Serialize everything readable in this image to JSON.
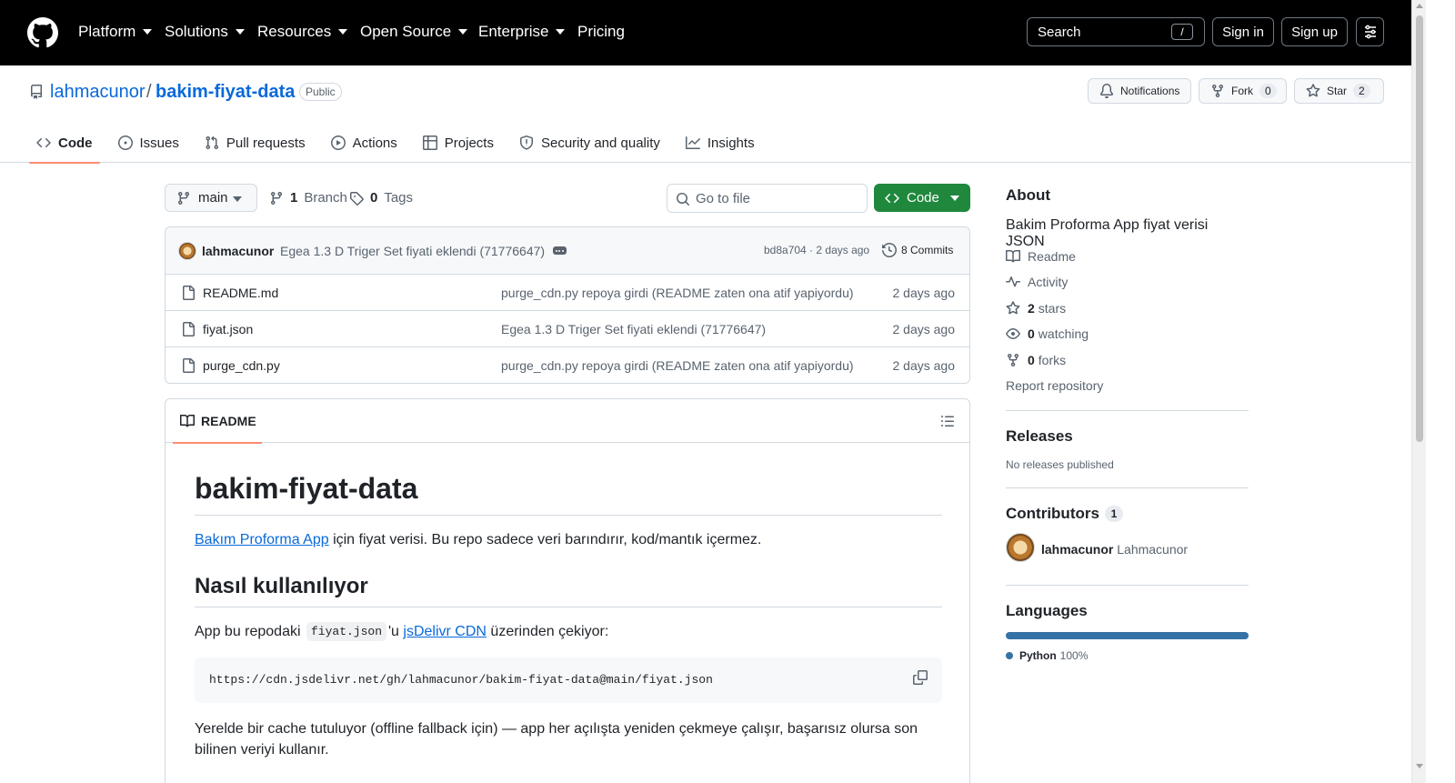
{
  "header": {
    "nav": [
      "Platform",
      "Solutions",
      "Resources",
      "Open Source",
      "Enterprise",
      "Pricing"
    ],
    "search_label": "Search",
    "search_kbd": "/",
    "sign_in": "Sign in",
    "sign_up": "Sign up"
  },
  "repo": {
    "owner": "lahmacunor",
    "separator": "/",
    "name": "bakim-fiyat-data",
    "visibility": "Public",
    "notifications_label": "Notifications",
    "fork_label": "Fork",
    "fork_count": "0",
    "star_label": "Star",
    "star_count": "2"
  },
  "tabs": [
    {
      "label": "Code",
      "icon": "code-icon",
      "active": true
    },
    {
      "label": "Issues",
      "icon": "issue-icon"
    },
    {
      "label": "Pull requests",
      "icon": "pull-request-icon"
    },
    {
      "label": "Actions",
      "icon": "play-icon"
    },
    {
      "label": "Projects",
      "icon": "table-icon"
    },
    {
      "label": "Security and quality",
      "icon": "shield-icon"
    },
    {
      "label": "Insights",
      "icon": "graph-icon"
    }
  ],
  "toolbar": {
    "branch": "main",
    "branch_count": "1",
    "branch_label": "Branch",
    "tag_count": "0",
    "tag_label": "Tags",
    "goto_placeholder": "Go to file",
    "code_label": "Code"
  },
  "latest_commit": {
    "author": "lahmacunor",
    "message": "Egea 1.3 D Triger Set fiyati eklendi (71776647)",
    "sha_time": "bd8a704 · 2 days ago",
    "commits_label": "8 Commits"
  },
  "files": [
    {
      "name": "README.md",
      "message": "purge_cdn.py repoya girdi (README zaten ona atif yapiyordu)",
      "date": "2 days ago"
    },
    {
      "name": "fiyat.json",
      "message": "Egea 1.3 D Triger Set fiyati eklendi (71776647)",
      "date": "2 days ago"
    },
    {
      "name": "purge_cdn.py",
      "message": "purge_cdn.py repoya girdi (README zaten ona atif yapiyordu)",
      "date": "2 days ago"
    }
  ],
  "readme": {
    "tab_label": "README",
    "h1": "bakim-fiyat-data",
    "p1_link": "Bakım Proforma App",
    "p1_rest": " için fiyat verisi. Bu repo sadece veri barındırır, kod/mantık içermez.",
    "h2": "Nasıl kullanılıyor",
    "p2_a": "App bu repodaki ",
    "p2_code": "fiyat.json",
    "p2_b": "'u ",
    "p2_link": "jsDelivr CDN",
    "p2_c": " üzerinden çekiyor:",
    "code_block": "https://cdn.jsdelivr.net/gh/lahmacunor/bakim-fiyat-data@main/fiyat.json",
    "p3": "Yerelde bir cache tutuluyor (offline fallback için) — app her açılışta yeniden çekmeye çalışır, başarısız olursa son bilinen veriyi kullanır."
  },
  "sidebar": {
    "about_title": "About",
    "description": "Bakim Proforma App fiyat verisi JSON",
    "readme_link": "Readme",
    "activity_link": "Activity",
    "stars_count": "2",
    "stars_label": "stars",
    "watching_count": "0",
    "watching_label": "watching",
    "forks_count": "0",
    "forks_label": "forks",
    "report_link": "Report repository",
    "releases_title": "Releases",
    "releases_empty": "No releases published",
    "contributors_title": "Contributors",
    "contributors_count": "1",
    "contributor_login": "lahmacunor",
    "contributor_name": "Lahmacunor",
    "languages_title": "Languages",
    "language_name": "Python",
    "language_pct": "100%",
    "language_color": "#3572a5"
  },
  "colors": {
    "accent_blue": "#0969da",
    "code_green": "#1f883d",
    "tab_underline": "#fd8c73"
  }
}
